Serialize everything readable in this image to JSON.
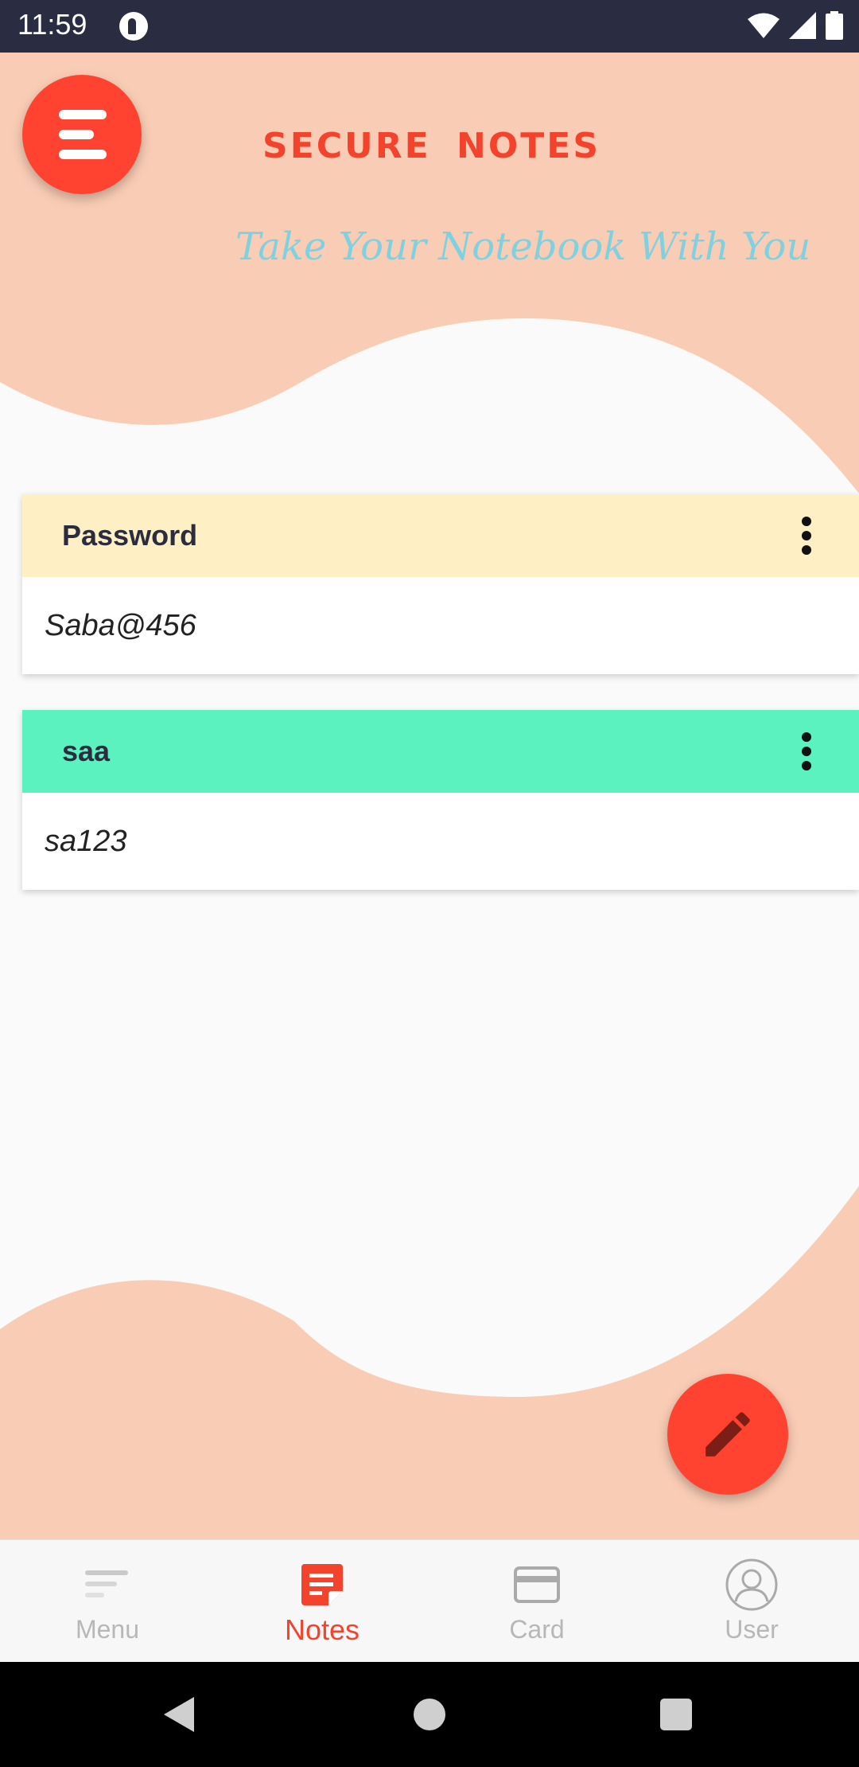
{
  "status_bar": {
    "time": "11:59"
  },
  "header": {
    "title": "SECURE NOTES",
    "subtitle": "Take Your Notebook With You"
  },
  "notes": [
    {
      "title": "Password",
      "content": "Saba@456",
      "color": "#ffefc4"
    },
    {
      "title": "saa",
      "content": "sa123",
      "color": "#5cf2c0"
    }
  ],
  "bottom_nav": {
    "items": [
      {
        "label": "Menu",
        "icon": "menu-lines-icon",
        "active": false
      },
      {
        "label": "Notes",
        "icon": "notes-icon",
        "active": true
      },
      {
        "label": "Card",
        "icon": "card-icon",
        "active": false
      },
      {
        "label": "User",
        "icon": "user-icon",
        "active": false
      }
    ]
  },
  "colors": {
    "accent": "#ff4330",
    "peach": "#f9cdb5",
    "subtitle": "#7fd1e0",
    "status_bar": "#2a2d41"
  }
}
